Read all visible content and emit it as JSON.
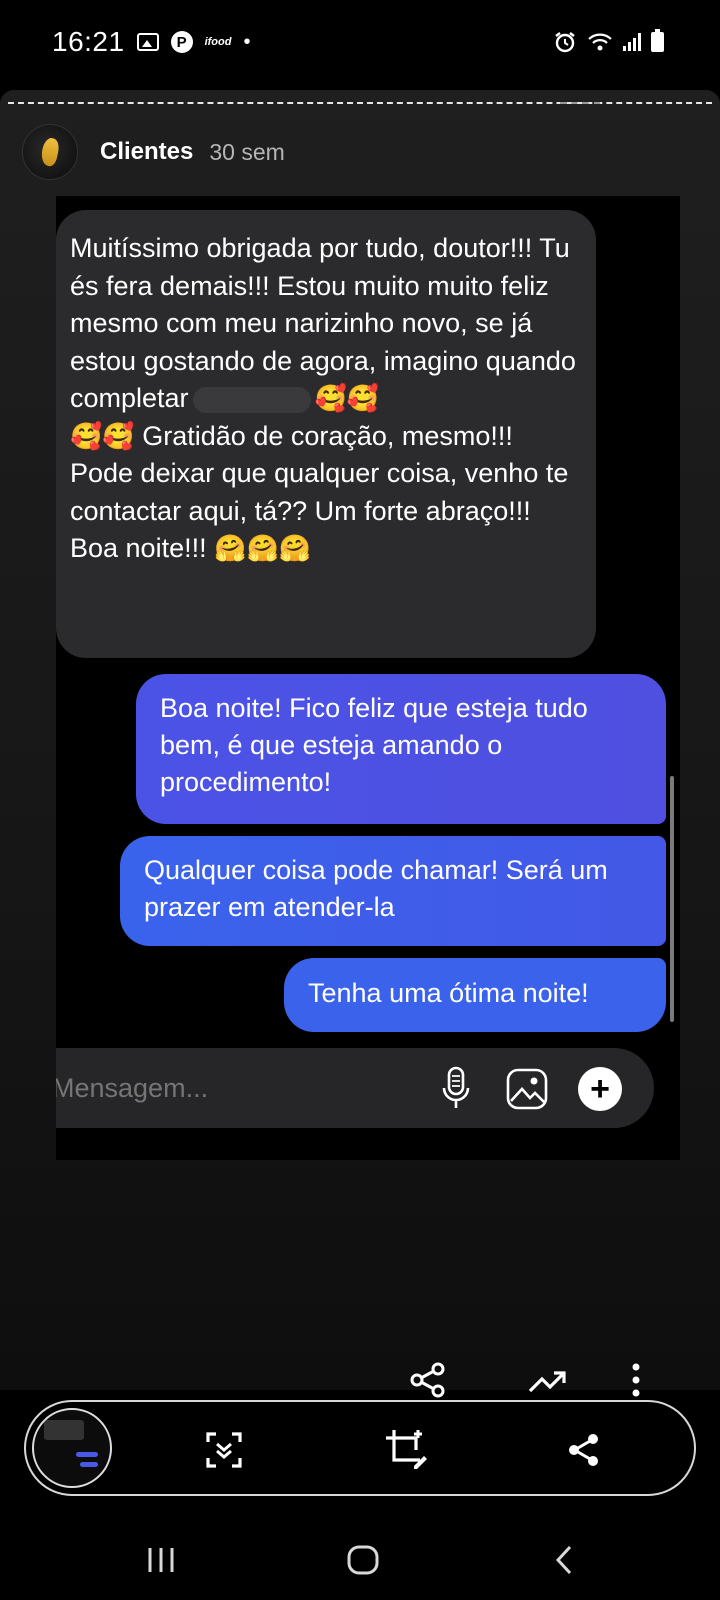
{
  "status_bar": {
    "time": "16:21",
    "notification_icons": [
      "gallery-icon",
      "pinterest-icon",
      "ifood-icon",
      "dot-icon"
    ],
    "ifood_label": "ifood",
    "right_icons": [
      "alarm-icon",
      "wifi-icon",
      "signal-icon",
      "battery-icon"
    ]
  },
  "story": {
    "account_name": "Clientes",
    "age": "30 sem",
    "accent_color": "#3d5be8"
  },
  "chat": {
    "incoming": {
      "text_part1": "Muitíssimo obrigada por tudo, doutor!!! Tu és fera demais!!! Estou muito muito feliz mesmo com meu narizinho novo, se já estou gostando de agora, imagino quando completar",
      "emoji_after_redaction": "🥰🥰",
      "emoji_line2": "🥰🥰",
      "text_part2": "Gratidão de coração, mesmo!!! Pode deixar que qualquer coisa, venho te contactar aqui, tá?? Um forte abraço!!! Boa noite!!!",
      "emoji_end": "🤗🤗🤗"
    },
    "outgoing": [
      {
        "text": "Boa noite! Fico feliz que esteja tudo bem, é que esteja amando o procedimento!"
      },
      {
        "text": "Qualquer coisa pode chamar! Será um prazer em atender-la"
      },
      {
        "text": "Tenha uma ótima noite!"
      }
    ],
    "composer": {
      "placeholder": "Mensagem...",
      "icons": [
        "microphone-icon",
        "image-icon",
        "plus-icon"
      ]
    }
  },
  "story_actions": [
    "share-icon",
    "insights-icon",
    "more-icon"
  ],
  "capture_toolbar": [
    "scroll-capture-icon",
    "crop-edit-icon",
    "share-icon"
  ],
  "nav_bar": [
    "recents-icon",
    "home-icon",
    "back-icon"
  ]
}
